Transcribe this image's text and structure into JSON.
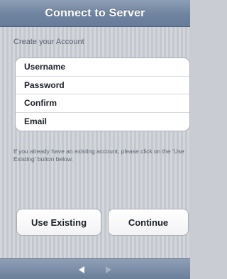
{
  "navbar": {
    "title": "Connect to Server"
  },
  "form": {
    "section_header": "Create your Account",
    "fields": [
      {
        "label": "Username"
      },
      {
        "label": "Password"
      },
      {
        "label": "Confirm"
      },
      {
        "label": "Email"
      }
    ],
    "help_text": "If you already have an existing account, please click on the 'Use Existing' button below."
  },
  "buttons": {
    "use_existing": "Use Existing",
    "continue": "Continue"
  },
  "toolbar": {
    "back_icon": "left-arrow",
    "forward_icon": "right-arrow",
    "forward_enabled": false
  },
  "colors": {
    "navbar": "#7a8da8",
    "background": "#cbced4",
    "text_secondary": "#5d6371"
  }
}
